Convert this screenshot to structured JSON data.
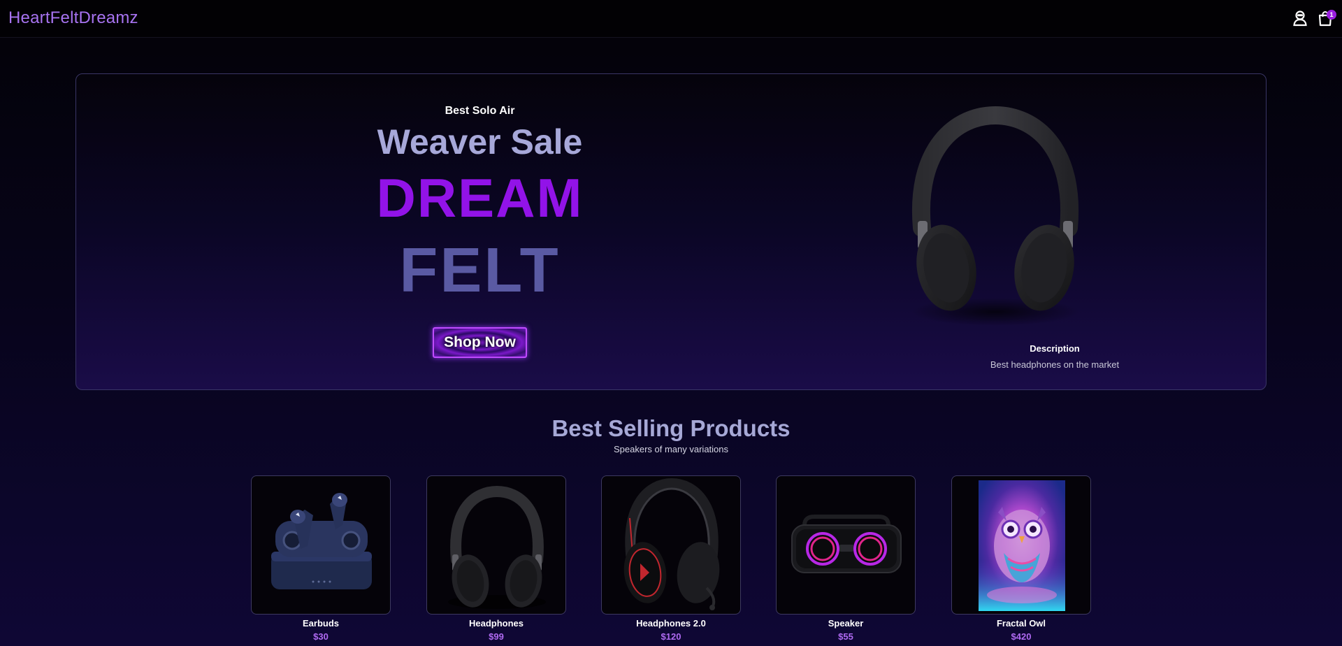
{
  "navbar": {
    "brand": "HeartFeltDreamz",
    "cart_count": "1",
    "icons": [
      "user-icon",
      "shopping-bag-icon"
    ]
  },
  "hero": {
    "small_text": "Best Solo Air",
    "mid_text": "Weaver Sale",
    "big_text_1": "DREAM",
    "big_text_2": "FELT",
    "button_label": "Shop Now",
    "description_title": "Description",
    "description_text": "Best headphones on the market"
  },
  "best_selling": {
    "title": "Best Selling Products",
    "subtitle": "Speakers of many variations",
    "products": [
      {
        "name": "Earbuds",
        "price": "$30"
      },
      {
        "name": "Headphones",
        "price": "$99"
      },
      {
        "name": "Headphones 2.0",
        "price": "$120"
      },
      {
        "name": "Speaker",
        "price": "$55"
      },
      {
        "name": "Fractal Owl",
        "price": "$420"
      }
    ]
  },
  "colors": {
    "brand": "#a773f0",
    "accent": "#9213e8",
    "price": "#b06af2",
    "felt": "#5a5aa3"
  }
}
